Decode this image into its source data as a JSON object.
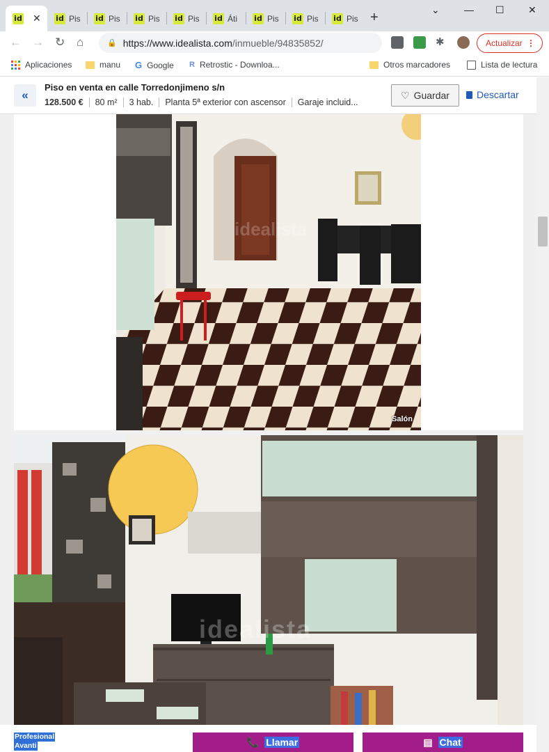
{
  "browser": {
    "tabs": [
      {
        "title": "",
        "active": true
      },
      {
        "title": "Pis"
      },
      {
        "title": "Pis"
      },
      {
        "title": "Pis"
      },
      {
        "title": "Pis"
      },
      {
        "title": "Áti"
      },
      {
        "title": "Pis"
      },
      {
        "title": "Pis"
      },
      {
        "title": "Pis"
      }
    ],
    "favicon_text": "id",
    "url_host": "https://www.idealista.com",
    "url_path": "/inmueble/94835852/",
    "update_label": "Actualizar",
    "bookmarks": {
      "apps": "Aplicaciones",
      "manu": "manu",
      "google": "Google",
      "retrostic": "Retrostic - Downloa...",
      "otros": "Otros marcadores",
      "lectura": "Lista de lectura"
    }
  },
  "listing": {
    "title": "Piso en venta en calle Torredonjimeno s/n",
    "price": "128.500 €",
    "size": "80 m²",
    "rooms": "3 hab.",
    "floor": "Planta 5ª exterior con ascensor",
    "garage": "Garaje incluid...",
    "save_label": "Guardar",
    "discard_label": "Descartar"
  },
  "photos": [
    {
      "label": "Salón",
      "watermark": "idealista"
    },
    {
      "watermark": "idealista"
    }
  ],
  "bottom": {
    "pro_line1": "Profesional",
    "pro_line2": "Avanti",
    "call_label": "Llamar",
    "chat_label": "Chat"
  },
  "colors": {
    "brand_blue": "#1e59b8",
    "cta_purple": "#a21d8a",
    "favicon": "#d7ea3a",
    "update_red": "#d93025"
  }
}
